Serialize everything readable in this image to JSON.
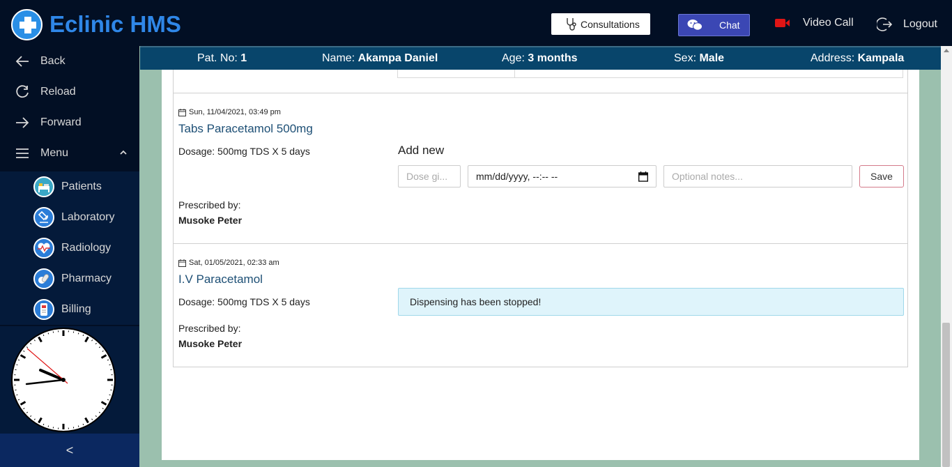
{
  "app": {
    "title": "Eclinic HMS"
  },
  "topnav": {
    "consultations": "Consultations",
    "chat": "Chat",
    "video_call": "Video Call",
    "logout": "Logout"
  },
  "sidebar": {
    "back": "Back",
    "reload": "Reload",
    "forward": "Forward",
    "menu": "Menu",
    "modules": [
      {
        "label": "Patients",
        "icon": "patients-icon"
      },
      {
        "label": "Laboratory",
        "icon": "laboratory-icon"
      },
      {
        "label": "Radiology",
        "icon": "radiology-icon"
      },
      {
        "label": "Pharmacy",
        "icon": "pharmacy-icon"
      },
      {
        "label": "Billing",
        "icon": "billing-icon"
      }
    ],
    "collapse": "<"
  },
  "patient": {
    "no_label": "Pat. No:",
    "no": "1",
    "name_label": "Name:",
    "name": "Akampa Daniel",
    "age_label": "Age:",
    "age": "3 months",
    "sex_label": "Sex:",
    "sex": "Male",
    "address_label": "Address:",
    "address": "Kampala"
  },
  "prescriptions": [
    {
      "date": "Sun, 11/04/2021, 03:49 pm",
      "drug": "Tabs Paracetamol 500mg",
      "dosage": "Dosage: 500mg TDS X 5 days",
      "prescribed_label": "Prescribed by:",
      "prescriber": "Musoke Peter"
    },
    {
      "date": "Sat, 01/05/2021, 02:33 am",
      "drug": "I.V Paracetamol",
      "dosage": "Dosage: 500mg TDS X 5 days",
      "prescribed_label": "Prescribed by:",
      "prescriber": "Musoke Peter",
      "status": "Dispensing has been stopped!"
    }
  ],
  "dispense_form": {
    "title": "Add new",
    "dose_placeholder": "Dose gi...",
    "date_value": "mm/dd/yyyy, --:-- --",
    "notes_placeholder": "Optional notes...",
    "save": "Save"
  },
  "colors": {
    "topbar": "#020f24",
    "brand": "#2f87e8",
    "patient_bar": "#08456b",
    "chat_button": "#3b47b4",
    "page_bg": "#9bc0ae",
    "alert_bg": "#dff4fb"
  }
}
